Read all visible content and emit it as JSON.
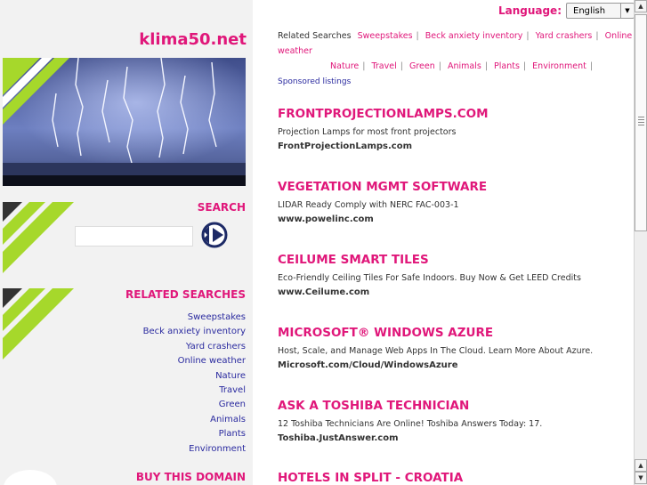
{
  "language": {
    "label": "Language:",
    "selected": "English"
  },
  "site": {
    "title": "klima50.net"
  },
  "search": {
    "title": "SEARCH",
    "value": ""
  },
  "related": {
    "title": "RELATED SEARCHES",
    "items": [
      "Sweepstakes",
      "Beck anxiety inventory",
      "Yard crashers",
      "Online weather",
      "Nature",
      "Travel",
      "Green",
      "Animals",
      "Plants",
      "Environment"
    ]
  },
  "related_bar": {
    "label": "Related Searches",
    "items": [
      "Sweepstakes",
      "Beck anxiety inventory",
      "Yard crashers",
      "Online weather",
      "Nature",
      "Travel",
      "Green",
      "Animals",
      "Plants",
      "Environment"
    ]
  },
  "buy_domain": {
    "title": "BUY THIS DOMAIN"
  },
  "sponsored": {
    "label": "Sponsored listings"
  },
  "ads": [
    {
      "title": "FRONTPROJECTIONLAMPS.COM",
      "desc": "Projection Lamps for most front projectors",
      "url": "FrontProjectionLamps.com"
    },
    {
      "title": "VEGETATION MGMT SOFTWARE",
      "desc": "LIDAR Ready Comply with NERC FAC-003-1",
      "url": "www.powelinc.com"
    },
    {
      "title": "CEILUME SMART TILES",
      "desc": "Eco-Friendly Ceiling Tiles For Safe Indoors. Buy Now & Get LEED Credits",
      "url": "www.Ceilume.com"
    },
    {
      "title": "MICROSOFT® WINDOWS AZURE",
      "desc": "Host, Scale, and Manage Web Apps In The Cloud. Learn More About Azure.",
      "url": "Microsoft.com/Cloud/WindowsAzure"
    },
    {
      "title": "ASK A TOSHIBA TECHNICIAN",
      "desc": "12 Toshiba Technicians Are Online! Toshiba Answers Today: 17.",
      "url": "Toshiba.JustAnswer.com"
    },
    {
      "title": "HOTELS IN SPLIT - CROATIA",
      "desc": "",
      "url": ""
    }
  ],
  "colors": {
    "accent": "#e0177a",
    "link": "#2a2a9f",
    "stripe": "#a6d82b",
    "panel": "#f2f2f2"
  },
  "icons": {
    "language_dropdown": "chevron-down-icon",
    "search_go": "circle-arrow-icon",
    "scroll_up": "arrow-up-icon",
    "scroll_down": "arrow-down-icon"
  }
}
